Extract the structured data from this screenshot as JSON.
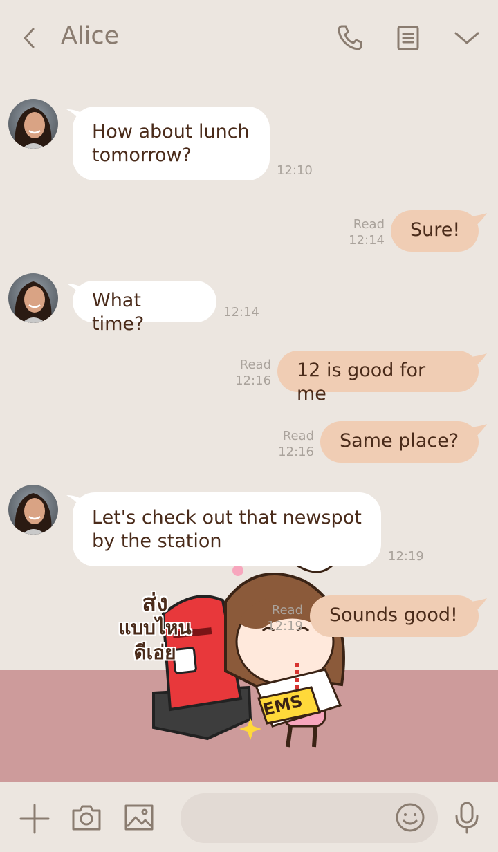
{
  "header": {
    "title": "Alice",
    "icons": [
      "back-chevron-icon",
      "phone-icon",
      "notes-icon",
      "chevron-down-icon"
    ]
  },
  "messages": [
    {
      "side": "in",
      "text1": "How about lunch",
      "text2": "tomorrow?",
      "time": "12:10"
    },
    {
      "side": "out",
      "text": "Sure!",
      "status": "Read",
      "time": "12:14"
    },
    {
      "side": "in",
      "text": "What time?",
      "time": "12:14"
    },
    {
      "side": "out",
      "text": "12 is good for me",
      "status": "Read",
      "time": "12:16"
    },
    {
      "side": "out",
      "text": "Same place?",
      "status": "Read",
      "time": "12:16"
    },
    {
      "side": "in",
      "text1": "Let's check out that newspot",
      "text2": "by the station",
      "time": "12:19"
    },
    {
      "side": "out",
      "text": "Sounds good!",
      "status": "Read",
      "time": "12:19"
    }
  ],
  "sticker": {
    "thai_line1": "ส่ง",
    "thai_line2": "แบบไหน",
    "thai_line3": "ดีเอ่ย",
    "box_label": "EMS"
  },
  "bottom_bar": {
    "icons": [
      "plus-icon",
      "camera-icon",
      "image-icon",
      "emoji-icon",
      "microphone-icon"
    ],
    "input_value": ""
  },
  "colors": {
    "background": "#ece6e0",
    "incoming_bubble": "#ffffff",
    "outgoing_bubble": "#f0cdb4",
    "text": "#4a2b1a",
    "meta": "#aaa39c",
    "floor": "#cd9b9b"
  }
}
